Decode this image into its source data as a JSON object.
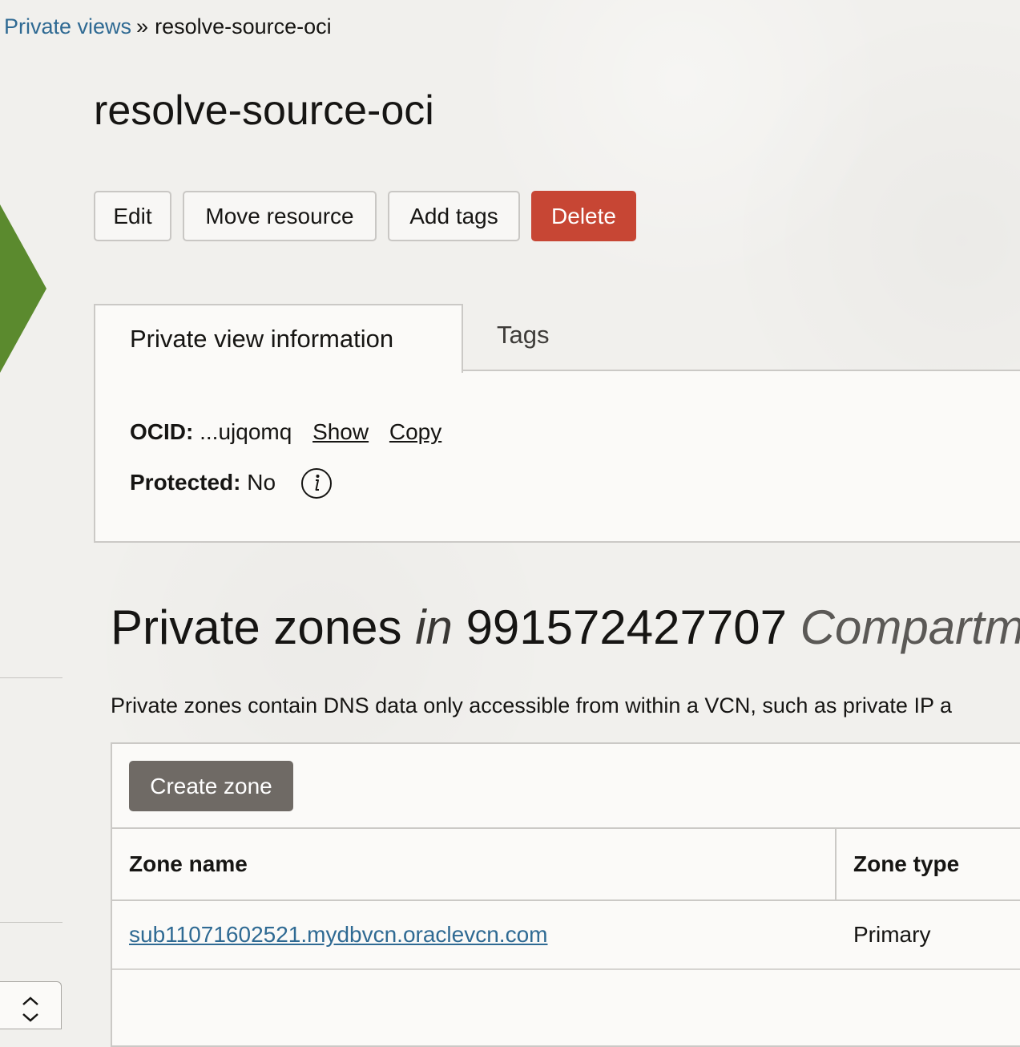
{
  "breadcrumb": {
    "parent_label": "Private views",
    "separator": "»",
    "current_label": "resolve-source-oci"
  },
  "page": {
    "title": "resolve-source-oci"
  },
  "actions": {
    "edit_label": "Edit",
    "move_label": "Move resource",
    "add_tags_label": "Add tags",
    "delete_label": "Delete"
  },
  "tabs": [
    {
      "label": "Private view information",
      "active": true
    },
    {
      "label": "Tags",
      "active": false
    }
  ],
  "info": {
    "ocid_label": "OCID:",
    "ocid_value": "...ujqomq",
    "show_label": "Show",
    "copy_label": "Copy",
    "protected_label": "Protected:",
    "protected_value": "No",
    "info_icon": "info-circle-icon"
  },
  "zones": {
    "title_main": "Private zones",
    "title_in": "in",
    "compartment_id": "991572427707",
    "compartment_word": "Compartme",
    "description": "Private zones contain DNS data only accessible from within a VCN, such as private IP a",
    "create_label": "Create zone",
    "columns": [
      "Zone name",
      "Zone type"
    ],
    "rows": [
      {
        "name": "sub11071602521.mydbvcn.oraclevcn.com",
        "type": "Primary"
      }
    ]
  },
  "colors": {
    "link": "#2f6a93",
    "delete": "#c74634",
    "create": "#6f6a65",
    "accent_green": "#5b8a2e"
  }
}
